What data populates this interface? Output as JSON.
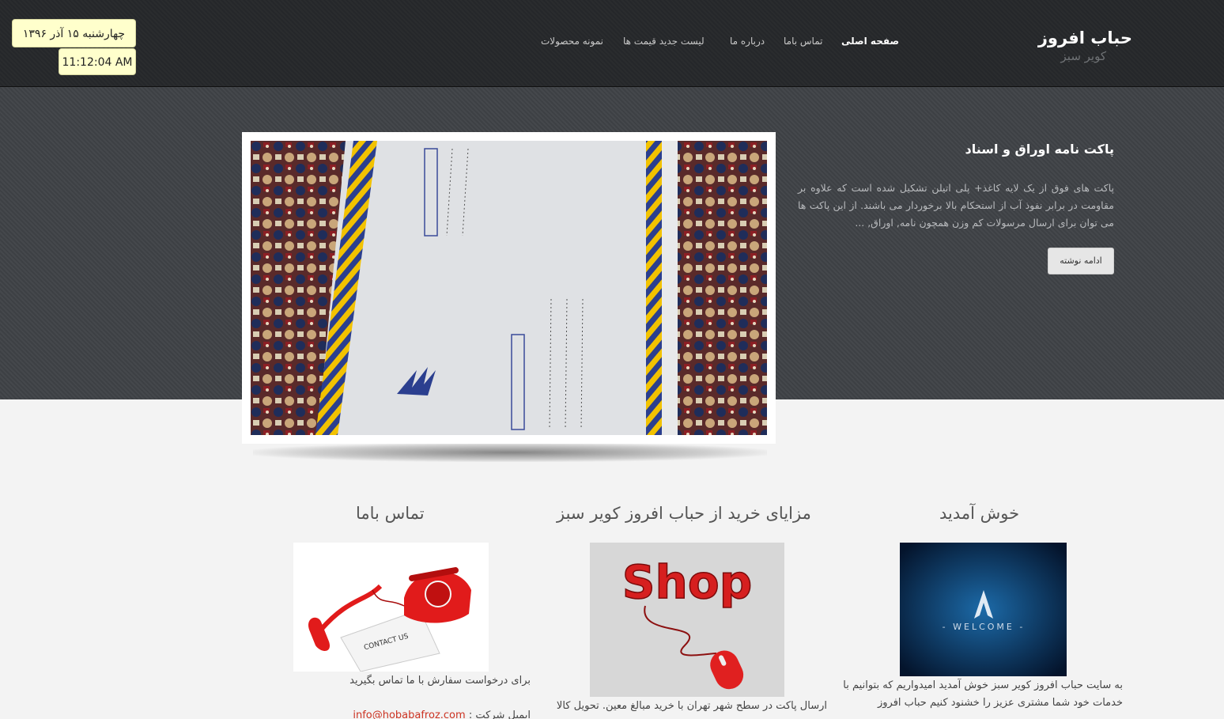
{
  "header": {
    "brand_title": "حباب افروز",
    "brand_subtitle": "کویر سبز",
    "nav": [
      {
        "label": "صفحه اصلی",
        "active": true
      },
      {
        "label": "تماس باما",
        "active": false
      },
      {
        "label": "درباره ما",
        "active": false
      },
      {
        "label": "لیست جدید قیمت ها",
        "active": false
      },
      {
        "label": "نمونه محصولات",
        "active": false
      }
    ]
  },
  "clock": {
    "date": "چهارشنبه ۱۵ آذر ۱۳۹۶",
    "time": "11:12:04 AM"
  },
  "hero": {
    "title": "پاکت نامه اوراق و اسناد",
    "text": "پاکت های فوق از یک لایه کاغذ+ پلی اتیلن تشکیل شده است که علاوه بر مقاومت در برابر نفوذ آب از استحکام بالا برخوردار می باشند. از این پاکت ها می توان برای ارسال مرسولات کم وزن همچون نامه, اوراق, ...",
    "button": "ادامه نوشته"
  },
  "columns": {
    "welcome": {
      "title": "خوش آمدید",
      "image_text": "- WELCOME -",
      "text": "به سایت حباب افروز کویر سبز خوش آمدید امیدواریم که بتوانیم با خدمات خود شما مشتری عزیز را خشنود کنیم حباب افروز"
    },
    "benefits": {
      "title": "مزایای خرید از حباب افروز کویر سبز",
      "image_text": "Shop",
      "text": "ارسال پاکت در سطح شهر تهران با خرید مبالغ معین. تحویل کالا"
    },
    "contact": {
      "title": "تماس باما",
      "image_text": "CONTACT US",
      "text": "برای درخواست سفارش با ما تماس بگیرید",
      "email_label": "ایمیل شرکت :",
      "email": "info@hobabafroz.com"
    }
  },
  "colors": {
    "header_bg": "#2a2c2e",
    "hero_bg": "#45484c",
    "clock_bg": "#ffffcc",
    "link": "#cc3322"
  }
}
